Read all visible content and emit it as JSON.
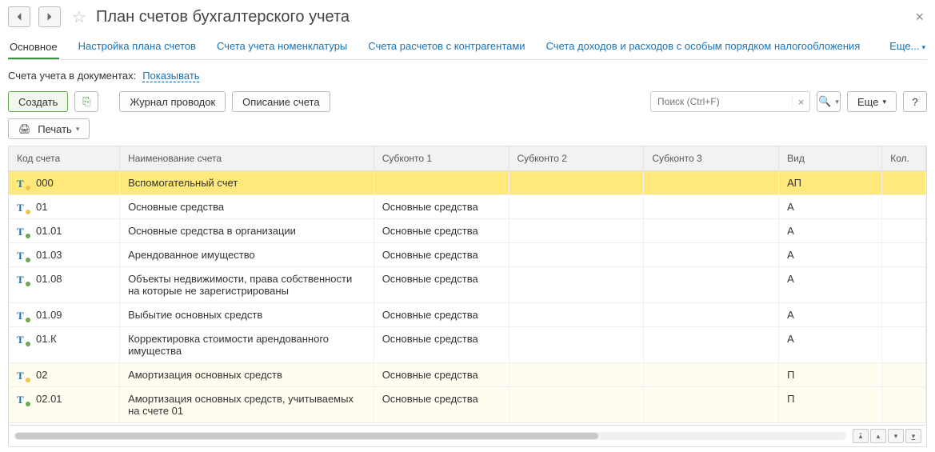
{
  "title": "План счетов бухгалтерского учета",
  "tabs": [
    "Основное",
    "Настройка плана счетов",
    "Счета учета номенклатуры",
    "Счета расчетов с контрагентами",
    "Счета доходов и расходов с особым порядком налогообложения",
    "Еще..."
  ],
  "docs_label": "Счета учета в документах:",
  "docs_link": "Показывать",
  "toolbar": {
    "create": "Создать",
    "journal": "Журнал проводок",
    "desc": "Описание счета",
    "search_placeholder": "Поиск (Ctrl+F)",
    "more": "Еще",
    "print": "Печать"
  },
  "columns": [
    "Код счета",
    "Наименование счета",
    "Субконто 1",
    "Субконто 2",
    "Субконто 3",
    "Вид",
    "Кол."
  ],
  "rows": [
    {
      "dot": "yellow",
      "code": "000",
      "name": "Вспомогательный счет",
      "s1": "",
      "vid": "АП",
      "sel": true
    },
    {
      "dot": "yellow",
      "code": "01",
      "name": "Основные средства",
      "s1": "Основные средства",
      "vid": "А"
    },
    {
      "dot": "green",
      "code": "01.01",
      "name": "Основные средства в организации",
      "s1": "Основные средства",
      "vid": "А"
    },
    {
      "dot": "green",
      "code": "01.03",
      "name": "Арендованное имущество",
      "s1": "Основные средства",
      "vid": "А"
    },
    {
      "dot": "green",
      "code": "01.08",
      "name": "Объекты недвижимости, права собственности на которые не зарегистрированы",
      "s1": "Основные средства",
      "vid": "А"
    },
    {
      "dot": "green",
      "code": "01.09",
      "name": "Выбытие основных средств",
      "s1": "Основные средства",
      "vid": "А"
    },
    {
      "dot": "green",
      "code": "01.К",
      "name": "Корректировка стоимости арендованного имущества",
      "s1": "Основные средства",
      "vid": "А"
    },
    {
      "dot": "yellow",
      "code": "02",
      "name": "Амортизация основных средств",
      "s1": "Основные средства",
      "vid": "П",
      "shade": true
    },
    {
      "dot": "green",
      "code": "02.01",
      "name": "Амортизация основных средств, учитываемых на счете 01",
      "s1": "Основные средства",
      "vid": "П",
      "shade": true
    }
  ]
}
